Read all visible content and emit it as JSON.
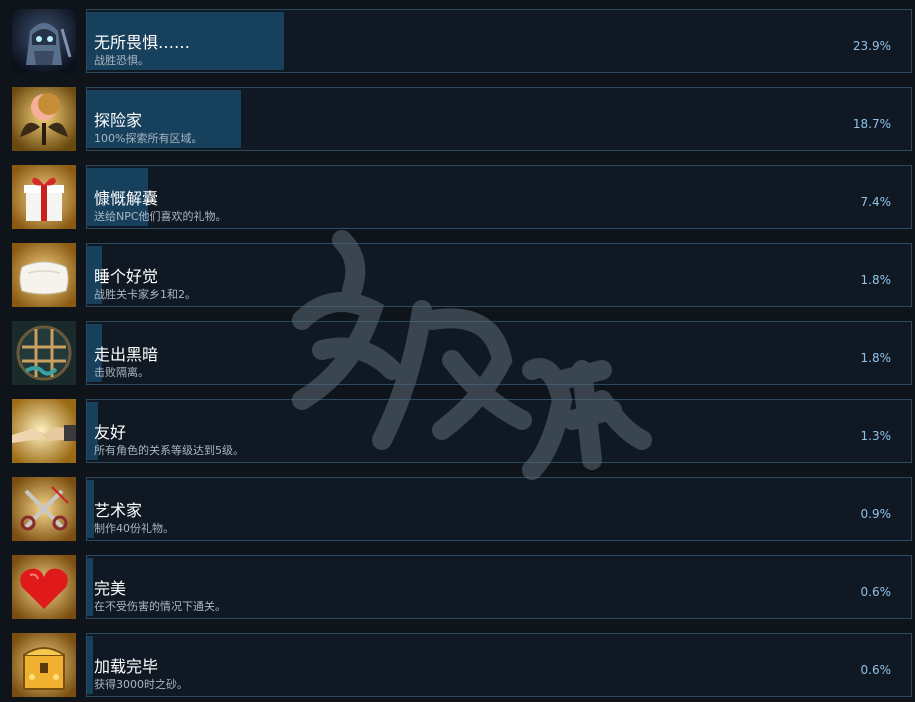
{
  "achievements": [
    {
      "icon": "ghost-knight-icon",
      "title": "无所畏惧……",
      "description": "战胜恐惧。",
      "percent": "23.9%",
      "fill": 0.239,
      "accent": "#a8d0e0"
    },
    {
      "icon": "crescent-moon-wings-icon",
      "title": "探险家",
      "description": "100%探索所有区域。",
      "percent": "18.7%",
      "fill": 0.187,
      "accent": "#f0a58a"
    },
    {
      "icon": "gift-box-icon",
      "title": "慷慨解囊",
      "description": "送给NPC他们喜欢的礼物。",
      "percent": "7.4%",
      "fill": 0.074,
      "accent": "#d62a2a"
    },
    {
      "icon": "pillow-icon",
      "title": "睡个好觉",
      "description": "战胜关卡家乡1和2。",
      "percent": "1.8%",
      "fill": 0.018,
      "accent": "#f2efe6"
    },
    {
      "icon": "cage-icon",
      "title": "走出黑暗",
      "description": "击败隔离。",
      "percent": "1.8%",
      "fill": 0.018,
      "accent": "#c9a060"
    },
    {
      "icon": "handshake-icon",
      "title": "友好",
      "description": "所有角色的关系等级达到5级。",
      "percent": "1.3%",
      "fill": 0.013,
      "accent": "#f0d6b0"
    },
    {
      "icon": "scissors-icon",
      "title": "艺术家",
      "description": "制作40份礼物。",
      "percent": "0.9%",
      "fill": 0.009,
      "accent": "#c8c8c8"
    },
    {
      "icon": "heart-icon",
      "title": "完美",
      "description": "在不受伤害的情况下通关。",
      "percent": "0.6%",
      "fill": 0.006,
      "accent": "#e01a1a"
    },
    {
      "icon": "treasure-chest-icon",
      "title": "加载完毕",
      "description": "获得3000时之砂。",
      "percent": "0.6%",
      "fill": 0.006,
      "accent": "#f0b030"
    }
  ],
  "colors": {
    "background": "#0f141b",
    "panel": "#101823",
    "panel_border": "#2a4a60",
    "progress_fill": "#17405c",
    "percent_text": "#8ec3ea",
    "icon_gold": "#d49a1c"
  }
}
